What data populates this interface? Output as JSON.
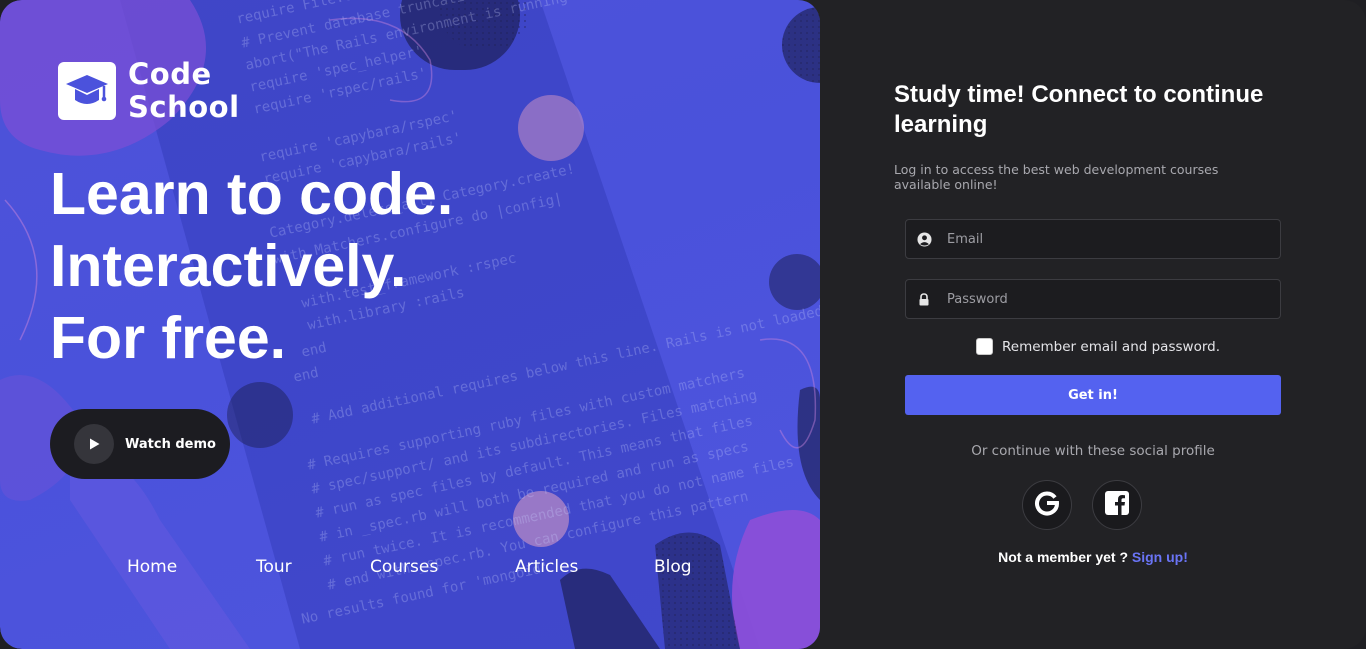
{
  "brand": {
    "line1": "Code",
    "line2": "School"
  },
  "hero": {
    "headline": [
      "Learn to code.",
      "Interactively.",
      "For free."
    ],
    "watch_demo_label": "Watch demo"
  },
  "nav": {
    "items": [
      "Home",
      "Tour",
      "Courses",
      "Articles",
      "Blog"
    ]
  },
  "login": {
    "title": "Study time! Connect to continue learning",
    "subtitle": "Log in to access the best web development courses available online!",
    "email_placeholder": "Email",
    "password_placeholder": "Password",
    "remember_label": "Remember email and password.",
    "remember_checked": false,
    "submit_label": "Get in!",
    "social_text": "Or continue with these social profile",
    "social_providers": [
      "google-icon",
      "facebook-icon"
    ],
    "member_text": "Not a member yet ?",
    "signup_link": "Sign up!"
  },
  "colors": {
    "hero_blue": "#4b52dc",
    "accent_purple": "#8a4fd8",
    "panel_dark": "#222225",
    "button_blue": "#5462f0",
    "link_blue": "#6a74f5"
  }
}
